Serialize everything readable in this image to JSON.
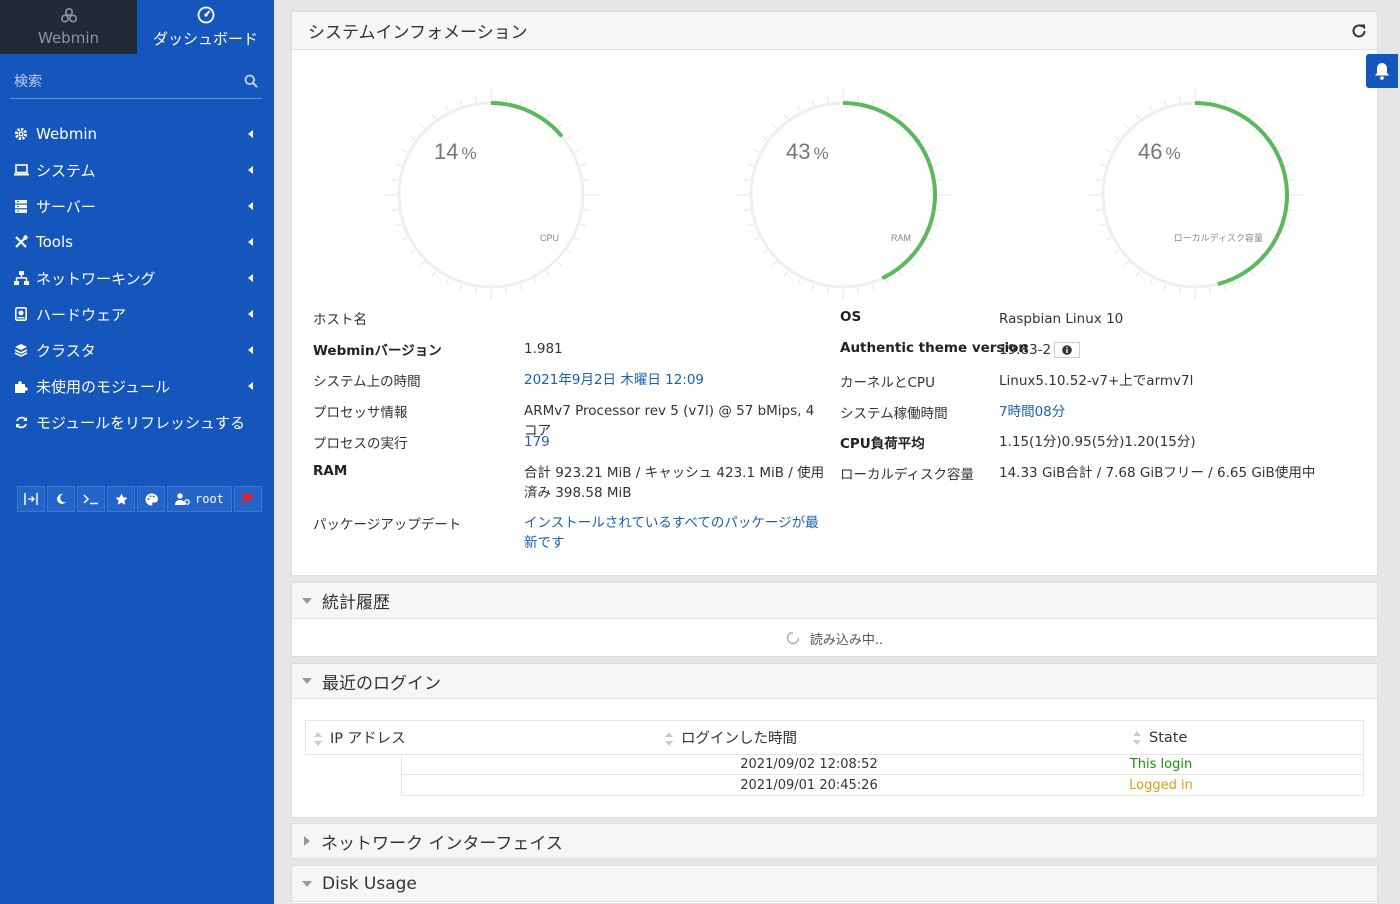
{
  "sidebar": {
    "tabs": [
      {
        "label": "Webmin",
        "icon": "webmin-logo-icon"
      },
      {
        "label": "ダッシュボード",
        "icon": "dashboard-icon"
      }
    ],
    "search_placeholder": "検索",
    "items": [
      {
        "label": "Webmin",
        "icon": "gear-icon"
      },
      {
        "label": "システム",
        "icon": "laptop-icon"
      },
      {
        "label": "サーバー",
        "icon": "server-icon"
      },
      {
        "label": "Tools",
        "icon": "tools-icon"
      },
      {
        "label": "ネットワーキング",
        "icon": "network-icon"
      },
      {
        "label": "ハードウェア",
        "icon": "hdd-icon"
      },
      {
        "label": "クラスタ",
        "icon": "layers-icon"
      },
      {
        "label": "未使用のモジュール",
        "icon": "puzzle-icon"
      },
      {
        "label": "モジュールをリフレッシュする",
        "icon": "refresh-icon"
      }
    ],
    "toolbar": {
      "user": "root"
    }
  },
  "system_info": {
    "title": "システムインフォメーション",
    "gauges": [
      {
        "value": 14,
        "unit": "%",
        "label": "CPU"
      },
      {
        "value": 43,
        "unit": "%",
        "label": "RAM"
      },
      {
        "value": 46,
        "unit": "%",
        "label": "ローカルディスク容量"
      }
    ],
    "left_rows": [
      {
        "label": "ホスト名",
        "value": "",
        "bold": false,
        "link": false
      },
      {
        "label": "Webminバージョン",
        "value": "1.981",
        "bold": true,
        "link": false
      },
      {
        "label": "システム上の時間",
        "value": "2021年9月2日 木曜日 12:09",
        "bold": false,
        "link": true
      },
      {
        "label": "プロセッサ情報",
        "value": "ARMv7 Processor rev 5 (v7l) @ 57 bMips, 4 コア",
        "bold": false,
        "link": false
      },
      {
        "label": "プロセスの実行",
        "value": "179",
        "bold": false,
        "link": true
      },
      {
        "label": "RAM",
        "value": "合計 923.21 MiB / キャッシュ 423.1 MiB / 使用済み 398.58 MiB",
        "bold": true,
        "link": false
      },
      {
        "label": "パッケージアップデート",
        "value": "インストールされているすべてのパッケージが最新です",
        "bold": false,
        "link": true
      }
    ],
    "right_rows": [
      {
        "label": "OS",
        "value": "Raspbian Linux 10",
        "bold": true,
        "link": false
      },
      {
        "label": "Authentic theme version",
        "value": "19.83-2",
        "bold": true,
        "link": false
      },
      {
        "label": "カーネルとCPU",
        "value": "Linux5.10.52-v7+上でarmv7l",
        "bold": false,
        "link": false
      },
      {
        "label": "システム稼働時間",
        "value": "7時間08分",
        "bold": false,
        "link": true
      },
      {
        "label": "CPU負荷平均",
        "value": "1.15(1分)0.95(5分)1.20(15分)",
        "bold": true,
        "link": false
      },
      {
        "label": "ローカルディスク容量",
        "value": "14.33 GiB合計 / 7.68 GiBフリー / 6.65 GiB使用中",
        "bold": false,
        "link": false
      }
    ]
  },
  "stats_history": {
    "title": "統計履歴",
    "loading": "読み込み中.."
  },
  "recent_logins": {
    "title": "最近のログイン",
    "columns": [
      "IP アドレス",
      "ログインした時間",
      "State"
    ],
    "rows": [
      {
        "ip": "",
        "time": "2021/09/02 12:08:52",
        "state": "This login",
        "state_color": "#1e8a10"
      },
      {
        "ip": "",
        "time": "2021/09/01 20:45:26",
        "state": "Logged in",
        "state_color": "#e39a0c"
      }
    ]
  },
  "network_interfaces": {
    "title": "ネットワーク インターフェイス"
  },
  "disk_usage": {
    "title": "Disk Usage"
  },
  "colors": {
    "sidebar": "#1556bd",
    "gauge": "#5cb85c",
    "link": "#1a5fb4"
  }
}
